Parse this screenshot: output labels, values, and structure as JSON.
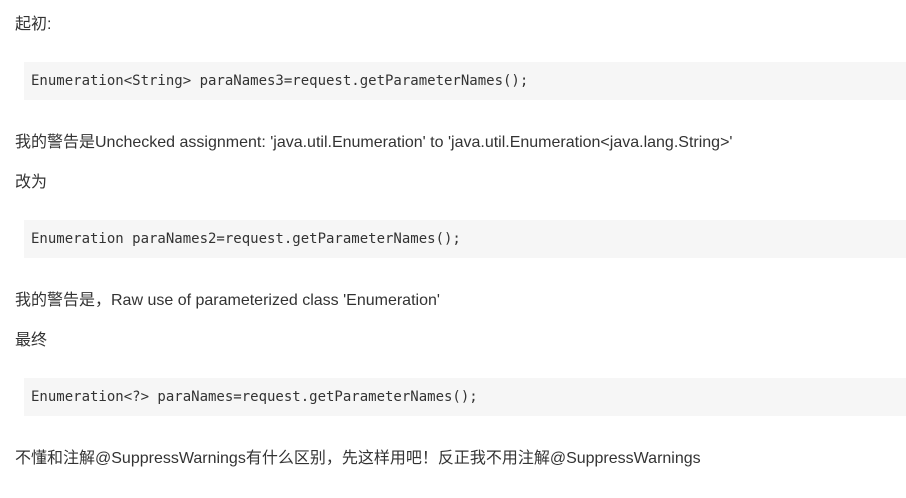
{
  "paragraphs": {
    "intro": "起初:",
    "warning1": "我的警告是Unchecked assignment: 'java.util.Enumeration' to 'java.util.Enumeration<java.lang.String>'",
    "changed": "改为",
    "warning2": "我的警告是，Raw use of parameterized class 'Enumeration'",
    "final": "最终",
    "conclusion": "不懂和注解@SuppressWarnings有什么区别，先这样用吧！反正我不用注解@SuppressWarnings"
  },
  "code": {
    "block1": "Enumeration<String> paraNames3=request.getParameterNames();",
    "block2": "Enumeration paraNames2=request.getParameterNames();",
    "block3": "Enumeration<?> paraNames=request.getParameterNames();"
  }
}
